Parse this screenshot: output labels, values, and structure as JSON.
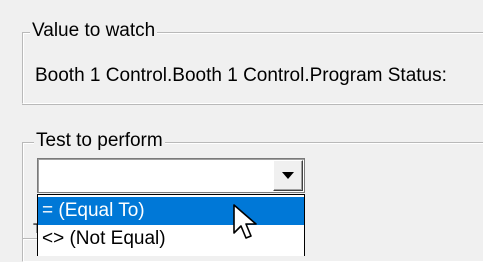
{
  "value_group": {
    "legend": "Value to watch",
    "value": "Booth 1 Control.Booth 1 Control.Program Status:"
  },
  "test_group": {
    "legend": "Test to perform",
    "combo": {
      "selected_value": "",
      "icon": "chevron-down-icon"
    },
    "options": [
      {
        "label": "= (Equal To)",
        "highlighted": true
      },
      {
        "label": "<> (Not Equal)",
        "highlighted": false
      }
    ]
  },
  "third_group": {
    "legend_fragment": "T"
  },
  "colors": {
    "window_background": "#f0f0f0",
    "highlight": "#0078d7",
    "highlight_text": "#ffffff"
  },
  "cursor": {
    "icon": "arrow-pointer-icon"
  }
}
